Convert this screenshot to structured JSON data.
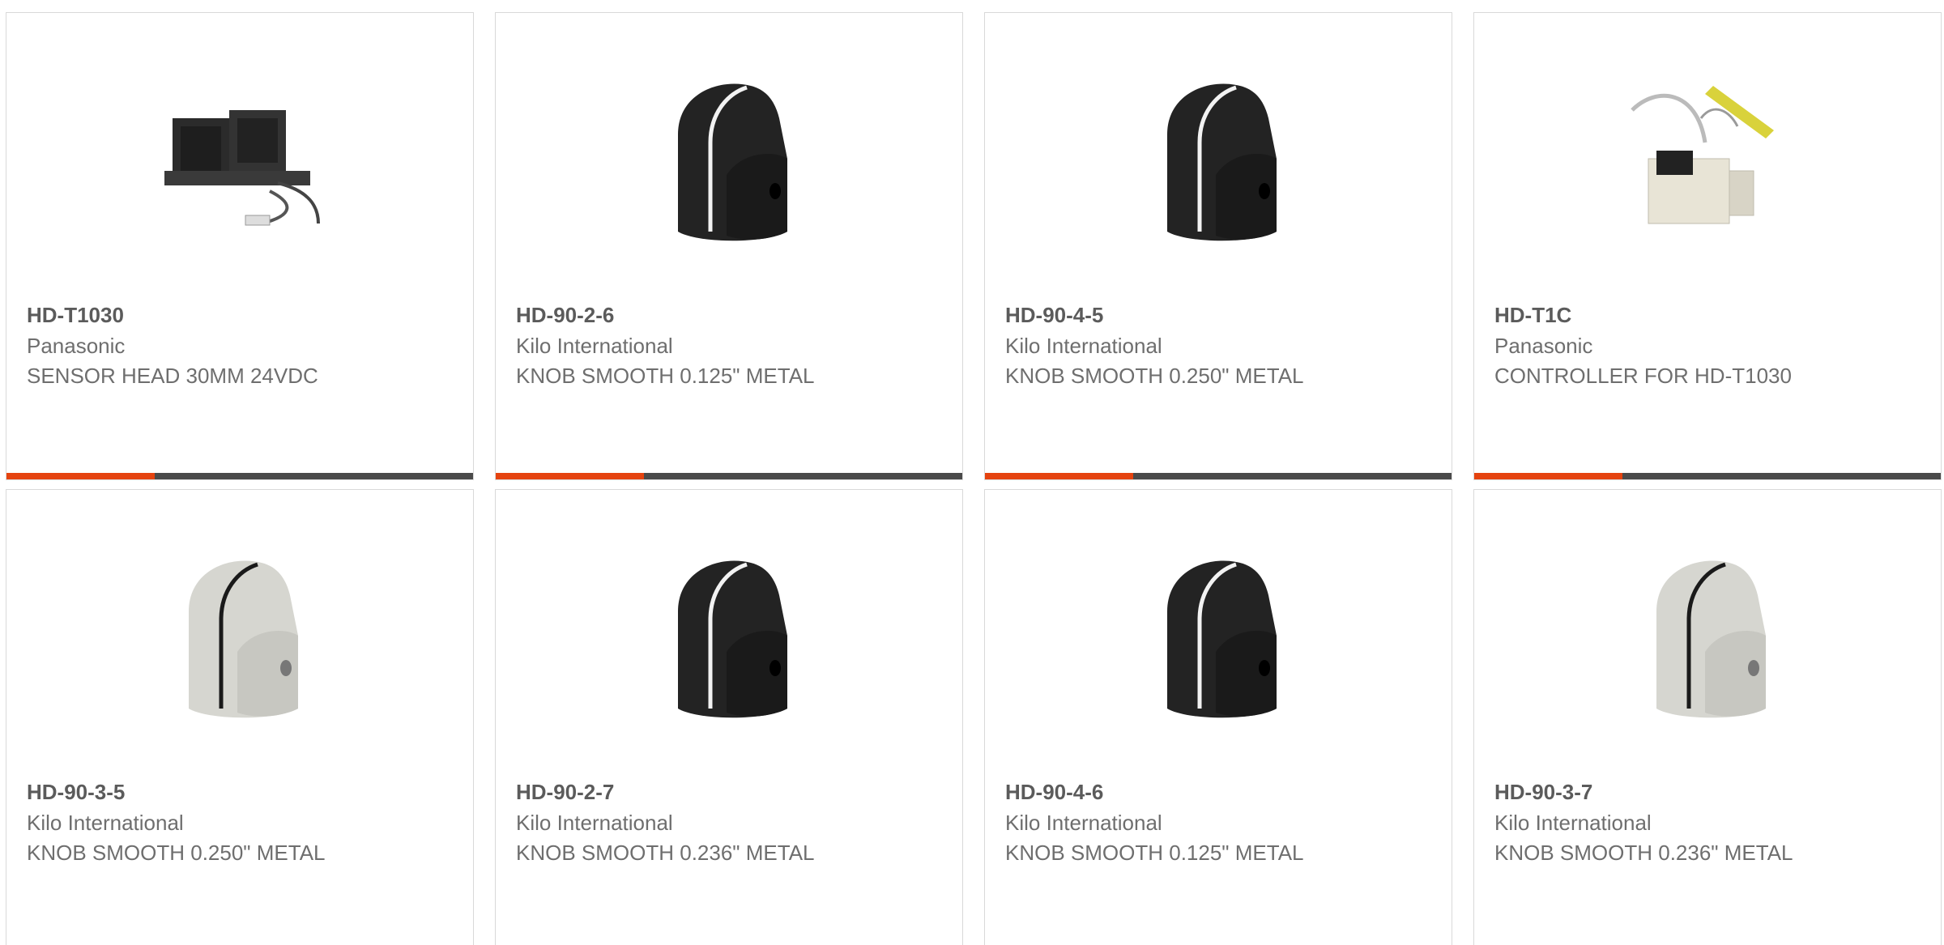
{
  "colors": {
    "accent": "#e5430f",
    "bar": "#4a4a4a",
    "border": "#d9d9d9",
    "text": "#6e6e6e"
  },
  "products": [
    {
      "part_number": "HD-T1030",
      "manufacturer": "Panasonic",
      "description": "SENSOR HEAD 30MM 24VDC",
      "image": "sensor-head-image"
    },
    {
      "part_number": "HD-90-2-6",
      "manufacturer": "Kilo International",
      "description": "KNOB SMOOTH 0.125\" METAL",
      "image": "black-knob-image"
    },
    {
      "part_number": "HD-90-4-5",
      "manufacturer": "Kilo International",
      "description": "KNOB SMOOTH 0.250\" METAL",
      "image": "black-knob-image"
    },
    {
      "part_number": "HD-T1C",
      "manufacturer": "Panasonic",
      "description": "CONTROLLER FOR HD-T1030",
      "image": "controller-image"
    },
    {
      "part_number": "HD-90-3-5",
      "manufacturer": "Kilo International",
      "description": "KNOB SMOOTH 0.250\" METAL",
      "image": "silver-knob-image"
    },
    {
      "part_number": "HD-90-2-7",
      "manufacturer": "Kilo International",
      "description": "KNOB SMOOTH 0.236\" METAL",
      "image": "black-knob-image"
    },
    {
      "part_number": "HD-90-4-6",
      "manufacturer": "Kilo International",
      "description": "KNOB SMOOTH 0.125\" METAL",
      "image": "black-knob-image"
    },
    {
      "part_number": "HD-90-3-7",
      "manufacturer": "Kilo International",
      "description": "KNOB SMOOTH 0.236\" METAL",
      "image": "silver-knob-image"
    }
  ]
}
